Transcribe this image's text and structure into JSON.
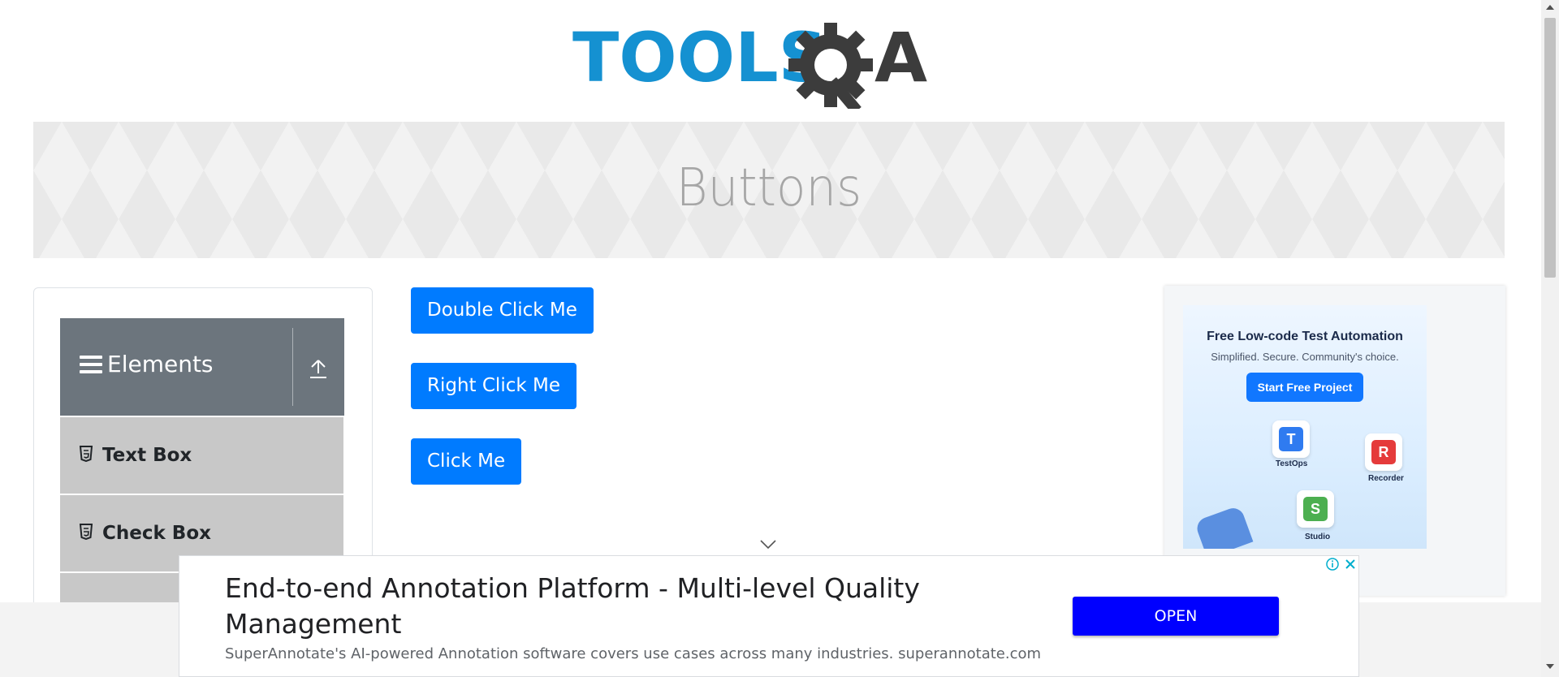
{
  "logo": {
    "text_left": "TOOLS",
    "text_right": "A"
  },
  "page": {
    "title": "Buttons"
  },
  "sidebar": {
    "group": {
      "label": "Elements"
    },
    "items": [
      {
        "label": "Text Box",
        "icon": "html5-icon"
      },
      {
        "label": "Check Box",
        "icon": "html5-icon"
      }
    ]
  },
  "buttons": {
    "double_click": "Double Click Me",
    "right_click": "Right Click Me",
    "click": "Click Me"
  },
  "ad_right": {
    "headline": "Free Low-code Test Automation",
    "subline": "Simplified. Secure. Community's choice.",
    "cta": "Start Free Project",
    "tiles": [
      "TestOps",
      "Recorder",
      "Studio"
    ]
  },
  "ad_bottom": {
    "headline": "End-to-end Annotation Platform - Multi-level Quality Management",
    "description": "SuperAnnotate's AI-powered Annotation software covers use cases across many industries. superannotate.com",
    "open_label": "OPEN"
  },
  "colors": {
    "primary": "#007bff",
    "logo_blue": "#1591d1",
    "logo_dark": "#3c3c3c",
    "ad_open": "#0000ff"
  }
}
